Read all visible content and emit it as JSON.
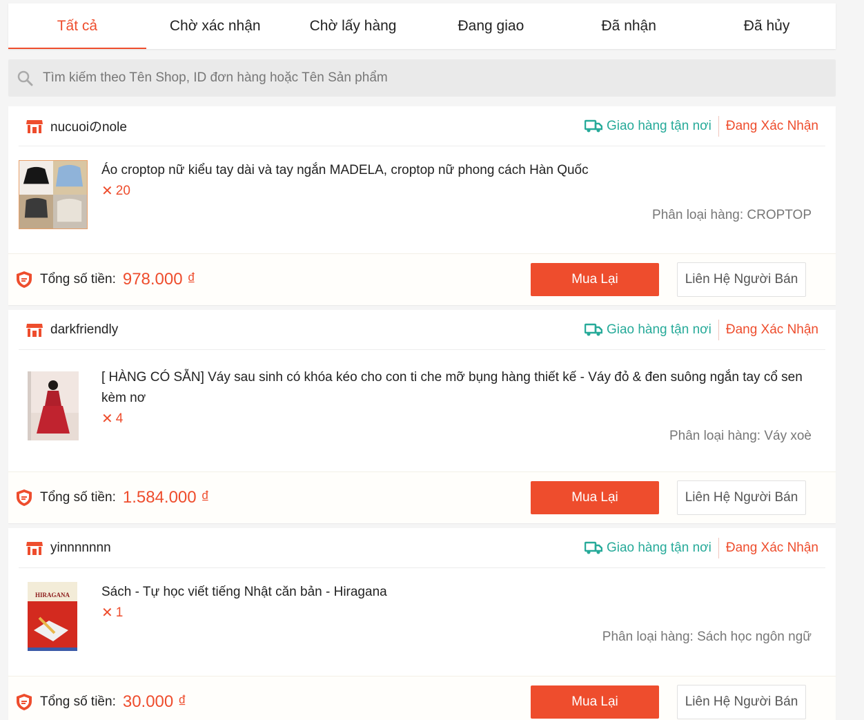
{
  "tabs": [
    {
      "label": "Tất cả",
      "active": true
    },
    {
      "label": "Chờ xác nhận",
      "active": false
    },
    {
      "label": "Chờ lấy hàng",
      "active": false
    },
    {
      "label": "Đang giao",
      "active": false
    },
    {
      "label": "Đã nhận",
      "active": false
    },
    {
      "label": "Đã hủy",
      "active": false
    }
  ],
  "search": {
    "placeholder": "Tìm kiếm theo Tên Shop, ID đơn hàng hoặc Tên Sản phẩm"
  },
  "colors": {
    "accent": "#ee4d2d",
    "shipping": "#26aa99"
  },
  "orders": [
    {
      "shop": "nucuoiのnole",
      "shipping": "Giao hàng tận nơi",
      "status": "Đang Xác Nhận",
      "item": {
        "name": "Áo croptop nữ kiểu tay dài và tay ngắn MADELA, croptop nữ phong cách Hàn Quốc",
        "qty": "20",
        "variant": "Phân loại hàng: CROPTOP"
      },
      "total_label": "Tổng số tiền:",
      "total": "978.000 ₫",
      "buy_again": "Mua Lại",
      "contact": "Liên Hệ Người Bán"
    },
    {
      "shop": "darkfriendly",
      "shipping": "Giao hàng tận nơi",
      "status": "Đang Xác Nhận",
      "item": {
        "name": "[ HÀNG CÓ SẴN] Váy sau sinh có khóa kéo cho con ti che mỡ bụng hàng thiết kế - Váy đỏ & đen suông ngắn tay cổ sen kèm nơ",
        "qty": "4",
        "variant": "Phân loại hàng: Váy xoè"
      },
      "total_label": "Tổng số tiền:",
      "total": "1.584.000 ₫",
      "buy_again": "Mua Lại",
      "contact": "Liên Hệ Người Bán"
    },
    {
      "shop": "yinnnnnnn",
      "shipping": "Giao hàng tận nơi",
      "status": "Đang Xác Nhận",
      "item": {
        "name": "Sách - Tự học viết tiếng Nhật căn bản - Hiragana",
        "qty": "1",
        "variant": "Phân loại hàng: Sách học ngôn ngữ",
        "cover_title": "HIRAGANA"
      },
      "total_label": "Tổng số tiền:",
      "total": "30.000 ₫",
      "buy_again": "Mua Lại",
      "contact": "Liên Hệ Người Bán"
    }
  ]
}
